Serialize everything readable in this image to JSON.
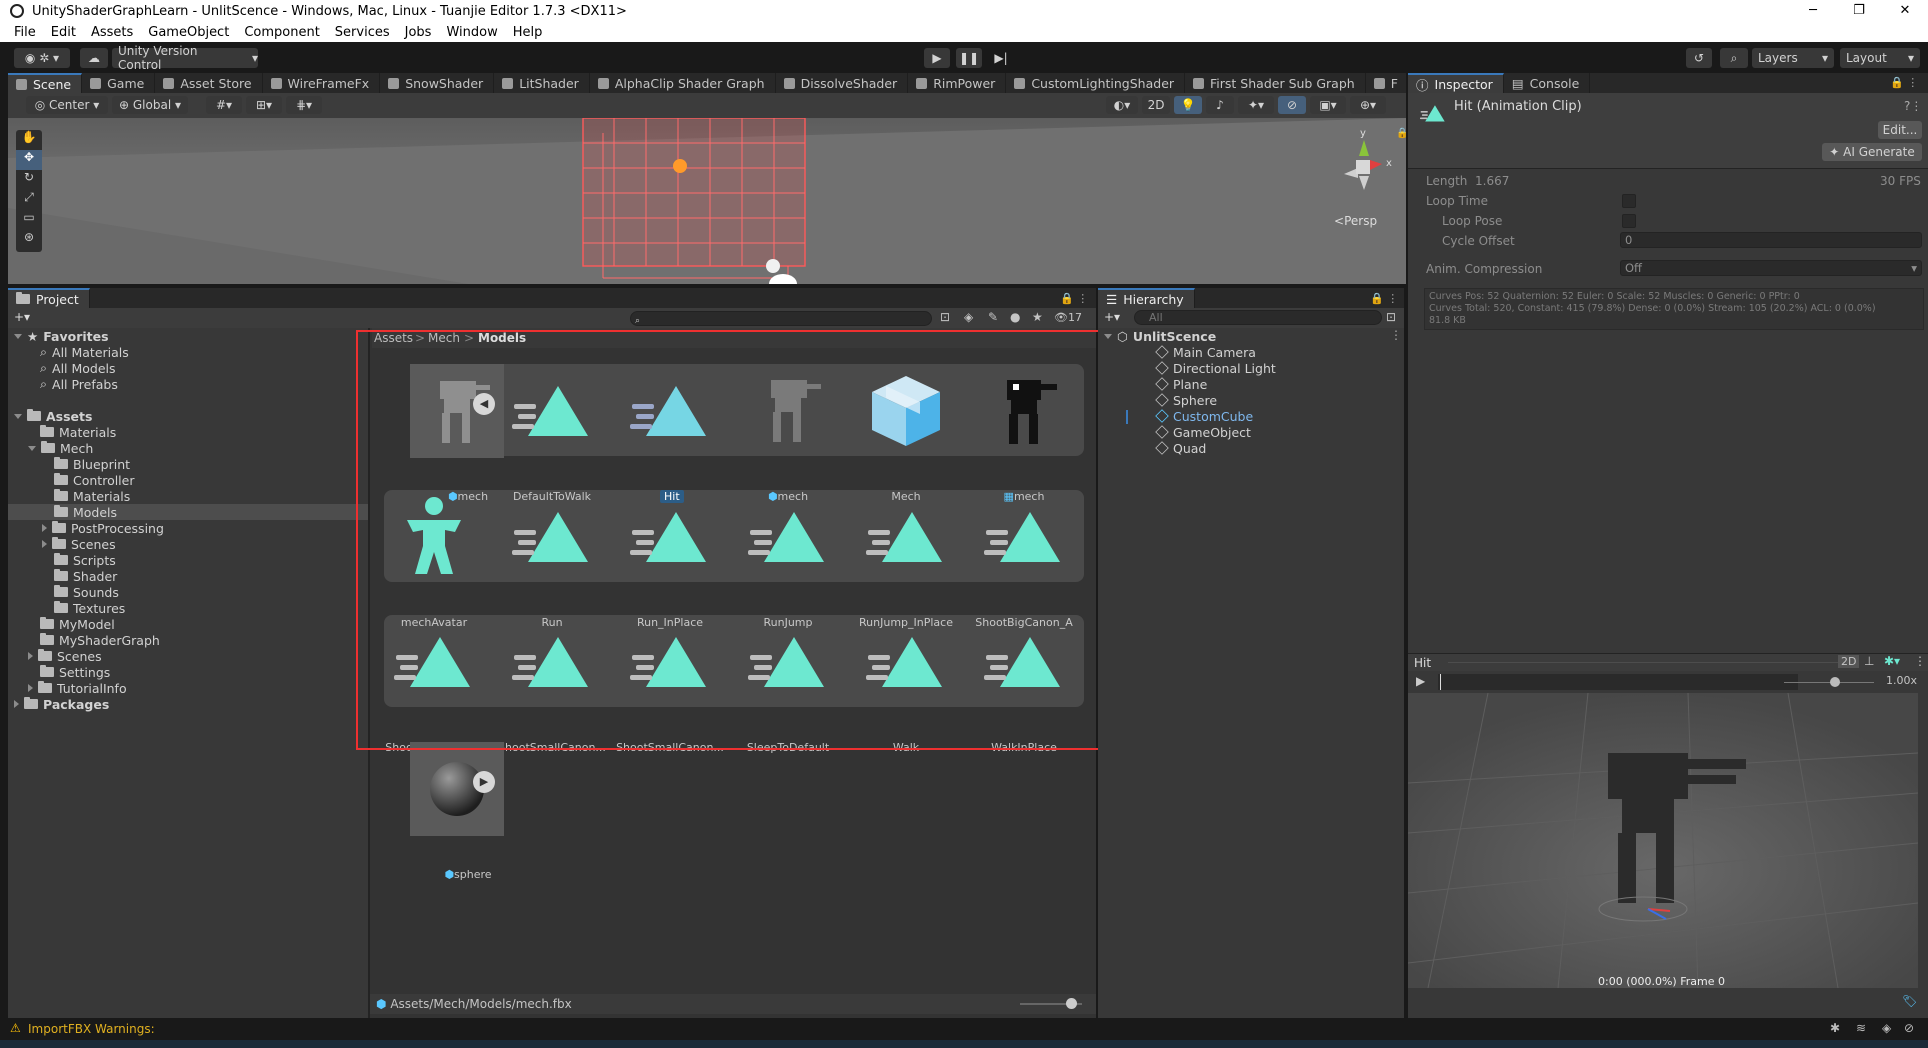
{
  "window": {
    "title": "UnityShaderGraphLearn - UnlitScence - Windows, Mac, Linux - Tuanjie Editor 1.7.3 <DX11>",
    "minimize": "─",
    "maximize": "❐",
    "close": "✕"
  },
  "menu": [
    "File",
    "Edit",
    "Assets",
    "GameObject",
    "Component",
    "Services",
    "Jobs",
    "Window",
    "Help"
  ],
  "toolbar": {
    "version_control": "Unity Version Control",
    "layers": "Layers",
    "layout": "Layout"
  },
  "scene_tabs": [
    "Scene",
    "Game",
    "Asset Store",
    "WireFrameFx",
    "SnowShader",
    "LitShader",
    "AlphaClip Shader Graph",
    "DissolveShader",
    "RimPower",
    "CustomLightingShader",
    "First Shader Sub Graph",
    "F"
  ],
  "scene_toolbar": {
    "pivot": "Center",
    "space": "Global",
    "mode_2d": "2D",
    "persp": "Persp",
    "gizmo_y": "y",
    "gizmo_x": "x"
  },
  "project": {
    "tab": "Project",
    "hidden_count": "17",
    "breadcrumb": [
      "Assets",
      "Mech",
      "Models"
    ],
    "favorites_label": "Favorites",
    "favorites": [
      "All Materials",
      "All Models",
      "All Prefabs"
    ],
    "tree": [
      {
        "label": "Assets",
        "depth": 0,
        "expanded": true,
        "bold": true
      },
      {
        "label": "Materials",
        "depth": 1
      },
      {
        "label": "Mech",
        "depth": 1,
        "expanded": true
      },
      {
        "label": "Blueprint",
        "depth": 2
      },
      {
        "label": "Controller",
        "depth": 2
      },
      {
        "label": "Materials",
        "depth": 2
      },
      {
        "label": "Models",
        "depth": 2,
        "selected": true
      },
      {
        "label": "PostProcessing",
        "depth": 2,
        "collapsed": true
      },
      {
        "label": "Scenes",
        "depth": 2,
        "collapsed": true
      },
      {
        "label": "Scripts",
        "depth": 2
      },
      {
        "label": "Shader",
        "depth": 2
      },
      {
        "label": "Sounds",
        "depth": 2
      },
      {
        "label": "Textures",
        "depth": 2
      },
      {
        "label": "MyModel",
        "depth": 1
      },
      {
        "label": "MyShaderGraph",
        "depth": 1
      },
      {
        "label": "Scenes",
        "depth": 1,
        "collapsed": true
      },
      {
        "label": "Settings",
        "depth": 1
      },
      {
        "label": "TutorialInfo",
        "depth": 1,
        "collapsed": true
      },
      {
        "label": "Packages",
        "depth": 0,
        "collapsed": true,
        "bold": true
      }
    ],
    "assets_row1": [
      {
        "label": "mech",
        "icon": "mech-model"
      },
      {
        "label": "DefaultToWalk",
        "icon": "anim-clip"
      },
      {
        "label": "Hit",
        "icon": "anim-clip",
        "selected": true
      },
      {
        "label": "mech",
        "icon": "mech-model"
      },
      {
        "label": "Mech",
        "icon": "prefab-box"
      },
      {
        "label": "mech",
        "icon": "mech-mesh"
      }
    ],
    "assets_row2": [
      {
        "label": "mechAvatar",
        "icon": "avatar"
      },
      {
        "label": "Run",
        "icon": "anim-clip"
      },
      {
        "label": "Run_InPlace",
        "icon": "anim-clip"
      },
      {
        "label": "RunJump",
        "icon": "anim-clip"
      },
      {
        "label": "RunJump_InPlace",
        "icon": "anim-clip"
      },
      {
        "label": "ShootBigCanon_A",
        "icon": "anim-clip"
      }
    ],
    "assets_row3": [
      {
        "label": "ShootBigCanon_B",
        "icon": "anim-clip"
      },
      {
        "label": "ShootSmallCanon...",
        "icon": "anim-clip"
      },
      {
        "label": "ShootSmallCanon...",
        "icon": "anim-clip"
      },
      {
        "label": "SleepToDefault",
        "icon": "anim-clip"
      },
      {
        "label": "Walk",
        "icon": "anim-clip"
      },
      {
        "label": "WalkInPlace",
        "icon": "anim-clip"
      }
    ],
    "sphere_asset": "sphere",
    "path": "Assets/Mech/Models/mech.fbx"
  },
  "hierarchy": {
    "tab": "Hierarchy",
    "search_placeholder": "All",
    "scene": "UnlitScence",
    "items": [
      "Main Camera",
      "Directional Light",
      "Plane",
      "Sphere",
      "CustomCube",
      "GameObject",
      "Quad"
    ],
    "highlighted": "CustomCube"
  },
  "inspector": {
    "tabs": [
      "Inspector",
      "Console"
    ],
    "title": "Hit (Animation Clip)",
    "edit_button": "Edit...",
    "ai_button": "AI Generate",
    "length_label": "Length",
    "length_value": "1.667",
    "fps": "30 FPS",
    "loop_time": "Loop Time",
    "loop_pose": "Loop Pose",
    "cycle_offset": "Cycle Offset",
    "cycle_offset_value": "0",
    "anim_compression": "Anim. Compression",
    "anim_compression_value": "Off",
    "info_line1": "Curves Pos: 52 Quaternion: 52 Euler: 0 Scale: 52 Muscles: 0 Generic: 0 PPtr: 0",
    "info_line2": "Curves Total: 520, Constant: 415 (79.8%) Dense: 0 (0.0%) Stream: 105 (20.2%) ACL: 0 (0.0%)",
    "info_line3": "81.8 KB"
  },
  "preview": {
    "title": "Hit",
    "mode_2d": "2D",
    "speed": "1.00x",
    "frame": "0:00 (000.0%) Frame 0",
    "progress": 0.0
  },
  "status": {
    "warning": "ImportFBX Warnings:"
  },
  "colors": {
    "accent": "#3a79bb",
    "anim": "#6de8d0",
    "selection": "#2c5d87",
    "highlight_red": "#ee3030",
    "warning": "#ffc107"
  }
}
